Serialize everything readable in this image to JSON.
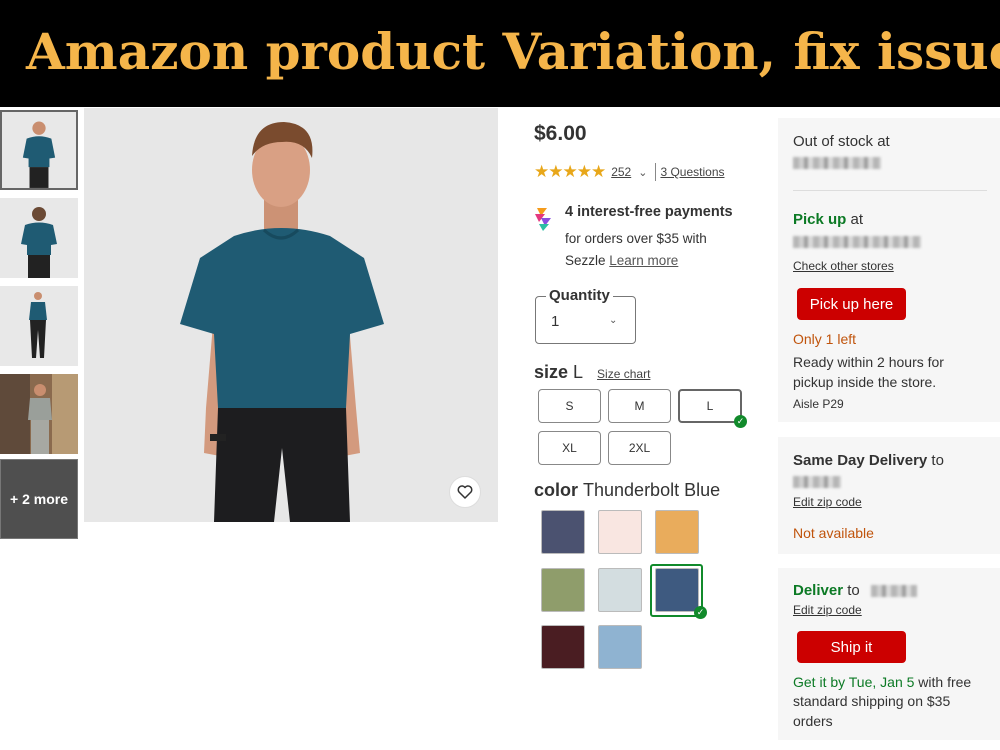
{
  "banner": {
    "title": "Amazon product Variation, fix issues"
  },
  "gallery": {
    "more_label": "+ 2 more",
    "shirt_color": "#1f5b73"
  },
  "product": {
    "price": "$6.00",
    "stars": "★★★★★",
    "review_count": "252",
    "questions": "3 Questions",
    "rating_value": 4.5
  },
  "payment": {
    "title": "4 interest-free payments",
    "line1": "for orders over $35 with",
    "line2_prefix": "Sezzle ",
    "learn_more": "Learn more"
  },
  "quantity": {
    "label": "Quantity",
    "value": "1"
  },
  "size": {
    "label": "size",
    "selected": "L",
    "chart_link": "Size chart",
    "options": [
      "S",
      "M",
      "L",
      "XL",
      "2XL"
    ]
  },
  "color": {
    "label": "color",
    "selected": "Thunderbolt Blue",
    "swatches": [
      "#4b5270",
      "#f9e6e1",
      "#e9ac5c",
      "#8f9d6b",
      "#d3dde0",
      "#3e5a80",
      "#4a1d22",
      "#8fb3d1"
    ]
  },
  "store": {
    "out_of_stock": "Out of stock at",
    "pickup_bold": "Pick up",
    "pickup_at": " at",
    "check_other": "Check other stores",
    "pickup_button": "Pick up here",
    "only_left": "Only 1 left",
    "ready_line1": "Ready within 2 hours for",
    "ready_line2": "pickup inside the store.",
    "aisle": "Aisle P29"
  },
  "same_day": {
    "title_bold": "Same Day Delivery",
    "title_rest": " to",
    "edit_zip": "Edit zip code",
    "status": "Not available"
  },
  "deliver": {
    "title_bold": "Deliver",
    "title_rest": " to",
    "edit_zip": "Edit zip code",
    "button": "Ship it",
    "eta_green": "Get it by Tue, Jan 5",
    "eta_rest": " with free",
    "line2": "standard shipping on $35",
    "line3": "orders"
  }
}
